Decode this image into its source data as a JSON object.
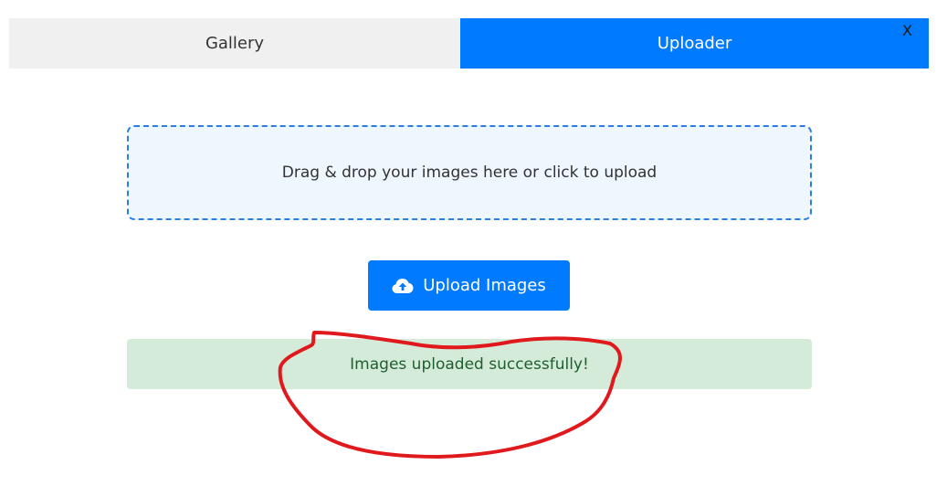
{
  "tabs": [
    {
      "label": "Gallery",
      "active": false
    },
    {
      "label": "Uploader",
      "active": true
    }
  ],
  "close_label": "X",
  "dropzone": {
    "text": "Drag & drop your images here or click to upload"
  },
  "upload_button": {
    "label": "Upload Images",
    "icon": "cloud-upload-icon"
  },
  "status": {
    "message": "Images uploaded successfully!"
  },
  "colors": {
    "accent": "#007bff",
    "tab_inactive_bg": "#f0f0f0",
    "dropzone_border": "#2a7de1",
    "dropzone_bg": "#eef6fe",
    "success_bg": "#d4ebd9",
    "success_text": "#1f5e2e",
    "annotation": "#e0191c"
  }
}
